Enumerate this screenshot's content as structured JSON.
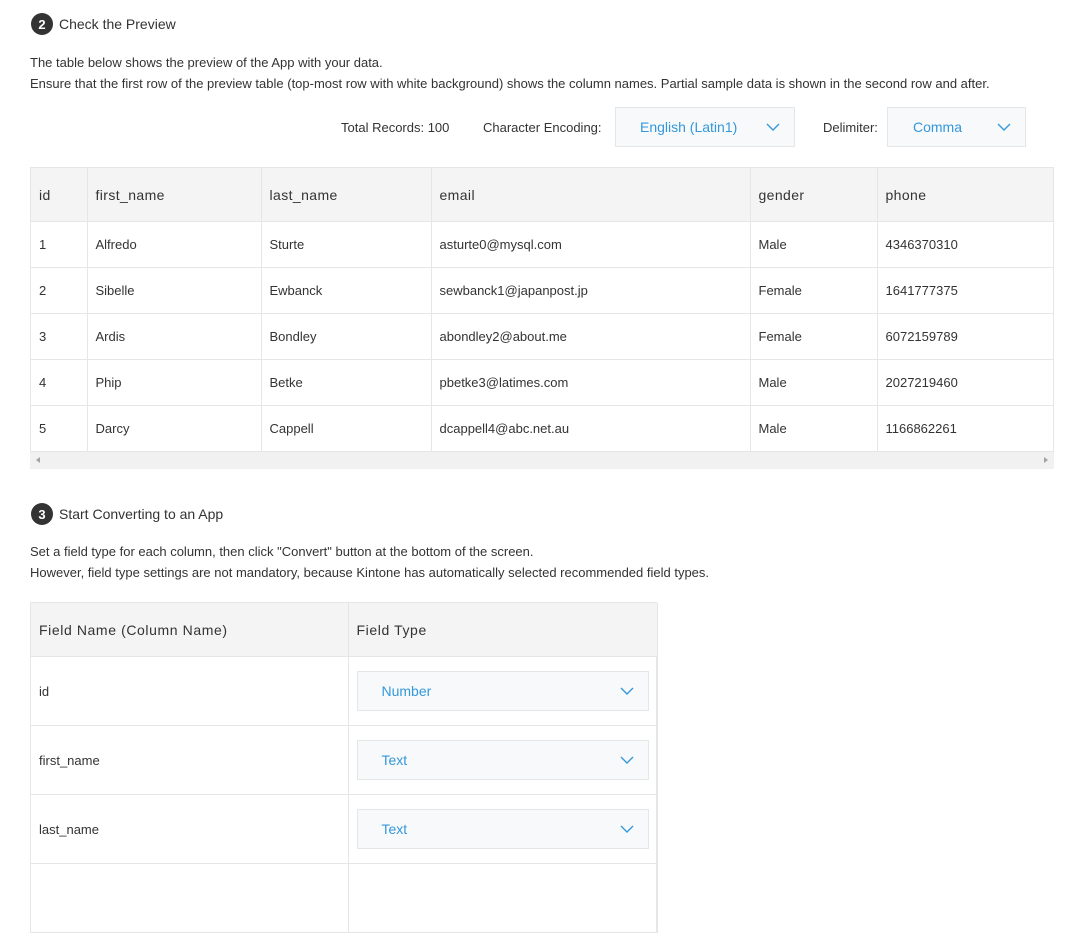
{
  "step2": {
    "number": "2",
    "title": "Check the Preview",
    "desc_line1": "The table below shows the preview of the App with your data.",
    "desc_line2": "Ensure that the first row of the preview table (top-most row with white background) shows the column names. Partial sample data is shown in the second row and after."
  },
  "meta": {
    "total_records": "Total Records: 100",
    "encoding_label": "Character Encoding:",
    "encoding_value": "English (Latin1)",
    "delimiter_label": "Delimiter:",
    "delimiter_value": "Comma"
  },
  "preview": {
    "columns": [
      "id",
      "first_name",
      "last_name",
      "email",
      "gender",
      "phone"
    ],
    "rows": [
      [
        "1",
        "Alfredo",
        "Sturte",
        "asturte0@mysql.com",
        "Male",
        "4346370310"
      ],
      [
        "2",
        "Sibelle",
        "Ewbanck",
        "sewbanck1@japanpost.jp",
        "Female",
        "1641777375"
      ],
      [
        "3",
        "Ardis",
        "Bondley",
        "abondley2@about.me",
        "Female",
        "6072159789"
      ],
      [
        "4",
        "Phip",
        "Betke",
        "pbetke3@latimes.com",
        "Male",
        "2027219460"
      ],
      [
        "5",
        "Darcy",
        "Cappell",
        "dcappell4@abc.net.au",
        "Male",
        "1166862261"
      ]
    ]
  },
  "step3": {
    "number": "3",
    "title": "Start Converting to an App",
    "desc_line1": "Set a field type for each column, then click \"Convert\" button at the bottom of the screen.",
    "desc_line2": "However, field type settings are not mandatory, because Kintone has automatically selected recommended field types."
  },
  "fields": {
    "header_name": "Field Name (Column Name)",
    "header_type": "Field Type",
    "rows": [
      {
        "name": "id",
        "type": "Number"
      },
      {
        "name": "first_name",
        "type": "Text"
      },
      {
        "name": "last_name",
        "type": "Text"
      }
    ]
  },
  "colors": {
    "accent": "#3498db",
    "border": "#e3e7e8",
    "header_bg": "#f4f4f4",
    "select_bg": "#f7f9fa",
    "badge_bg": "#333333"
  },
  "icons": {
    "step_badge": "circle-number",
    "dropdown": "chevron-down-icon",
    "scroll_left": "triangle-left-icon",
    "scroll_right": "triangle-right-icon"
  }
}
